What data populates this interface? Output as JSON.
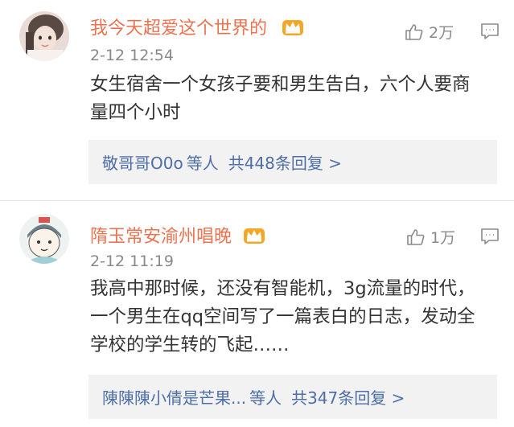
{
  "comments": [
    {
      "username": "我今天超爱这个世界的",
      "time": "2-12 12:54",
      "likes": "2万",
      "text": "女生宿舍一个女孩子要和男生告白，六个人要商量四个小时",
      "reply_names": "敬哥哥O0o",
      "reply_suffix": "等人",
      "reply_count": "共448条回复 >"
    },
    {
      "username": "隋玉常安渝州唱晚",
      "time": "2-12 11:19",
      "likes": "1万",
      "text": "我高中那时候，还没有智能机，3g流量的时代，一个男生在qq空间写了一篇表白的日志，发动全学校的学生转的飞起……",
      "reply_names": "陳陳陳小倩是芒果...",
      "reply_suffix": "等人",
      "reply_count": "共347条回复 >"
    }
  ],
  "icons": {
    "badge": "crown-badge-icon",
    "like": "thumbs-up-icon",
    "reply": "comment-icon"
  },
  "colors": {
    "username": "#eb7350",
    "link": "#4e6ea8",
    "muted": "#8a8a8a",
    "reply_bg": "#f2f2f2"
  }
}
